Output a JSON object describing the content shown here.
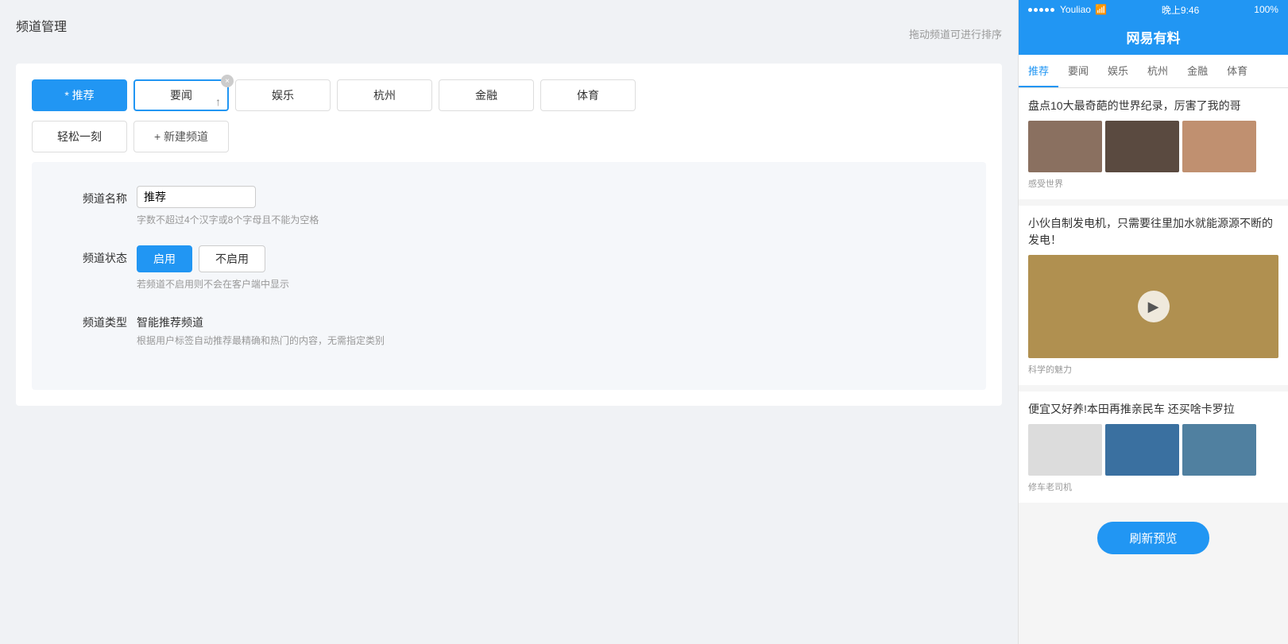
{
  "page": {
    "title": "频道管理",
    "drag_hint": "拖动频道可进行排序"
  },
  "tabs": [
    {
      "id": "tuijian",
      "label": "* 推荐",
      "active": true,
      "closable": false
    },
    {
      "id": "yaojian",
      "label": "要闻",
      "selected_outline": true,
      "closable": true,
      "cursor": true
    },
    {
      "id": "yule",
      "label": "娱乐",
      "active": false,
      "closable": false
    },
    {
      "id": "hangzhou",
      "label": "杭州",
      "active": false,
      "closable": false
    },
    {
      "id": "jinrong",
      "label": "金融",
      "active": false,
      "closable": false
    },
    {
      "id": "tiyu",
      "label": "体育",
      "active": false,
      "closable": false
    }
  ],
  "extra_tabs": [
    {
      "id": "qingsong",
      "label": "轻松一刻"
    },
    {
      "id": "new",
      "label": "+ 新建频道"
    }
  ],
  "form": {
    "name_label": "频道名称",
    "name_value": "推荐",
    "name_hint": "字数不超过4个汉字或8个字母且不能为空格",
    "status_label": "频道状态",
    "status_enable": "启用",
    "status_disable": "不启用",
    "status_hint": "若频道不启用则不会在客户端中显示",
    "type_label": "频道类型",
    "type_value": "智能推荐频道",
    "type_hint": "根据用户标签自动推荐最精确和热门的内容，无需指定类别"
  },
  "phone": {
    "status": {
      "dots": 5,
      "network": "Youliao",
      "wifi": "WiFi",
      "time": "晚上9:46",
      "battery": "100%"
    },
    "app_title": "网易有料",
    "nav_tabs": [
      {
        "id": "tuijian",
        "label": "推荐",
        "active": true
      },
      {
        "id": "yaojian",
        "label": "要闻",
        "active": false
      },
      {
        "id": "yule",
        "label": "娱乐",
        "active": false
      },
      {
        "id": "hangzhou",
        "label": "杭州",
        "active": false
      },
      {
        "id": "jinrong",
        "label": "金融",
        "active": false
      },
      {
        "id": "tiyu",
        "label": "体育",
        "active": false
      }
    ],
    "news_items": [
      {
        "id": 1,
        "title": "盘点10大最奇葩的世界纪录，厉害了我的哥",
        "images": [
          {
            "color": "#b0a090",
            "alt": "sculpture"
          },
          {
            "color": "#6b5c50",
            "alt": "chocolate"
          },
          {
            "color": "#c8a080",
            "alt": "art"
          }
        ],
        "source": "感受世界",
        "has_large_img": false
      },
      {
        "id": 2,
        "title": "小伙自制发电机，只需要往里加水就能源源不断的发电！",
        "large_img": {
          "color": "#c0a060",
          "has_video": true
        },
        "source": "科学的魅力",
        "has_large_img": true
      },
      {
        "id": 3,
        "title": "便宜又好养!本田再推亲民车 还买啥卡罗拉",
        "images": [
          {
            "color": "#e8e8e8",
            "alt": "white car"
          },
          {
            "color": "#4080b0",
            "alt": "blue car"
          },
          {
            "color": "#6090b0",
            "alt": "another car"
          }
        ],
        "source": "修车老司机",
        "has_large_img": false
      }
    ],
    "refresh_btn": "刷新预览"
  }
}
